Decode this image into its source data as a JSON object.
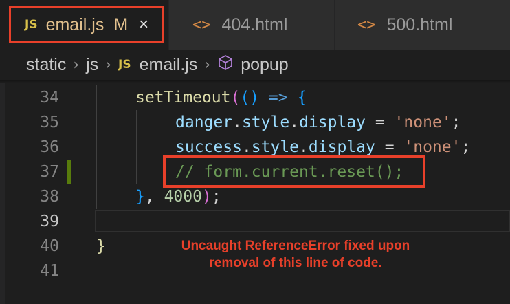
{
  "tabs": [
    {
      "icon": "JS",
      "label": "email.js",
      "modified": "M",
      "close": "×"
    },
    {
      "icon": "<>",
      "label": "404.html"
    },
    {
      "icon": "<>",
      "label": "500.html"
    }
  ],
  "breadcrumb": [
    "static",
    "js",
    "email.js",
    "popup"
  ],
  "breadcrumb_js_icon": "JS",
  "breadcrumb_sep": "›",
  "code": {
    "line_numbers": [
      "34",
      "35",
      "36",
      "37",
      "38",
      "39",
      "40",
      "41"
    ],
    "l34": {
      "fn": "setTimeout",
      "p_open": "(",
      "p_inner": "()",
      "arrow": " => ",
      "brace": "{"
    },
    "l35": {
      "obj": "danger",
      "dot1": ".",
      "prop1": "style",
      "dot2": ".",
      "prop2": "display",
      "eq": " = ",
      "str": "'none'",
      "semi": ";"
    },
    "l36": {
      "obj": "success",
      "dot1": ".",
      "prop1": "style",
      "dot2": ".",
      "prop2": "display",
      "eq": " = ",
      "str": "'none'",
      "semi": ";"
    },
    "l37": {
      "comment": "// form.current.reset();"
    },
    "l38": {
      "brace": "}",
      "comma": ", ",
      "num": "4000",
      "p_close": ")",
      "semi": ";"
    },
    "l40": {
      "brace": "}"
    }
  },
  "annotation": {
    "line1": "Uncaught ReferenceError fixed upon",
    "line2": "removal of this line of code."
  },
  "colors": {
    "highlight_red": "#e8402a",
    "editor_bg": "#1e1e1e"
  }
}
